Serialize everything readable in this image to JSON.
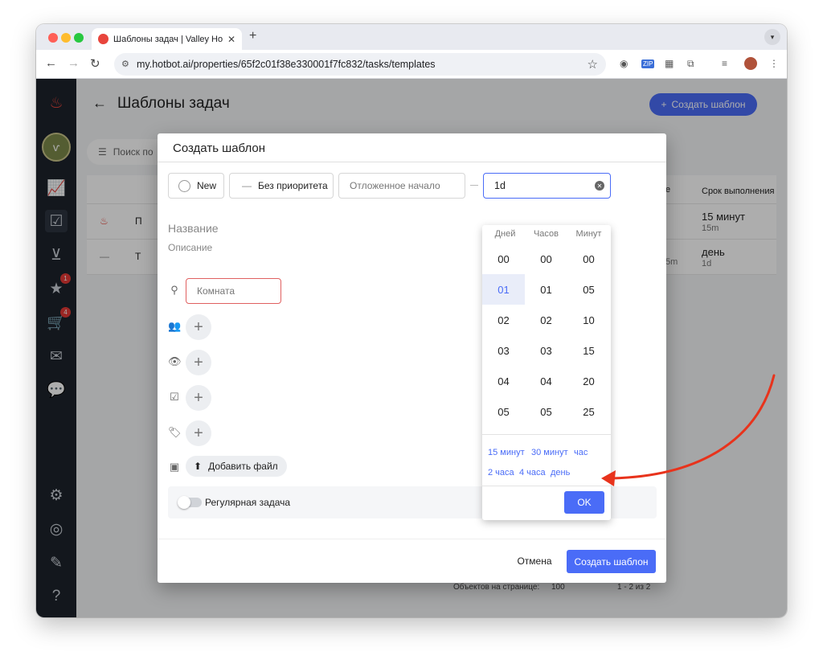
{
  "browser": {
    "tab_title": "Шаблоны задач | Valley Hotel",
    "tab_close": "✕",
    "new_tab": "+",
    "url": "my.hotbot.ai/properties/65f2c01f38e330001f7fc832/tasks/templates"
  },
  "sidebar": {
    "badge_rewards": "1",
    "badge_cart": "4"
  },
  "page": {
    "title": "Шаблоны задач",
    "create_button": "Создать шаблон",
    "search_placeholder": "Поиск по",
    "col_due": "Срок выполнения",
    "col_e": "е",
    "rows": [
      {
        "name": "П",
        "due": "15 минут",
        "due_short": "15m",
        "extra": ""
      },
      {
        "name": "Т",
        "due": "день",
        "due_short": "1d",
        "extra": "5m"
      }
    ],
    "pagination": {
      "per_page_label": "Объектов на странице:",
      "per_page_value": "100",
      "range": "1 - 2 из 2"
    }
  },
  "dialog": {
    "title": "Создать шаблон",
    "status": "New",
    "priority": "Без приоритета",
    "delayed_start": "Отложенное начало",
    "duration_value": "1d",
    "name_placeholder": "Название",
    "description_placeholder": "Описание",
    "room_placeholder": "Комната",
    "add_file": "Добавить файл",
    "regular_task": "Регулярная задача",
    "cancel": "Отмена",
    "create": "Создать шаблон"
  },
  "picker": {
    "col_days": "Дней",
    "col_hours": "Часов",
    "col_minutes": "Минут",
    "days": [
      "00",
      "01",
      "02",
      "03",
      "04",
      "05"
    ],
    "hours": [
      "00",
      "01",
      "02",
      "03",
      "04",
      "05"
    ],
    "minutes": [
      "00",
      "05",
      "10",
      "15",
      "20",
      "25"
    ],
    "selected_day": "01",
    "presets_row1": [
      "15 минут",
      "30 минут",
      "час"
    ],
    "presets_row2": [
      "2 часа",
      "4 часа",
      "день"
    ],
    "ok": "OK"
  },
  "colors": {
    "accent": "#4a6cf7",
    "annotation_arrow": "#e8331c",
    "sidebar_bg": "#1d232b"
  }
}
